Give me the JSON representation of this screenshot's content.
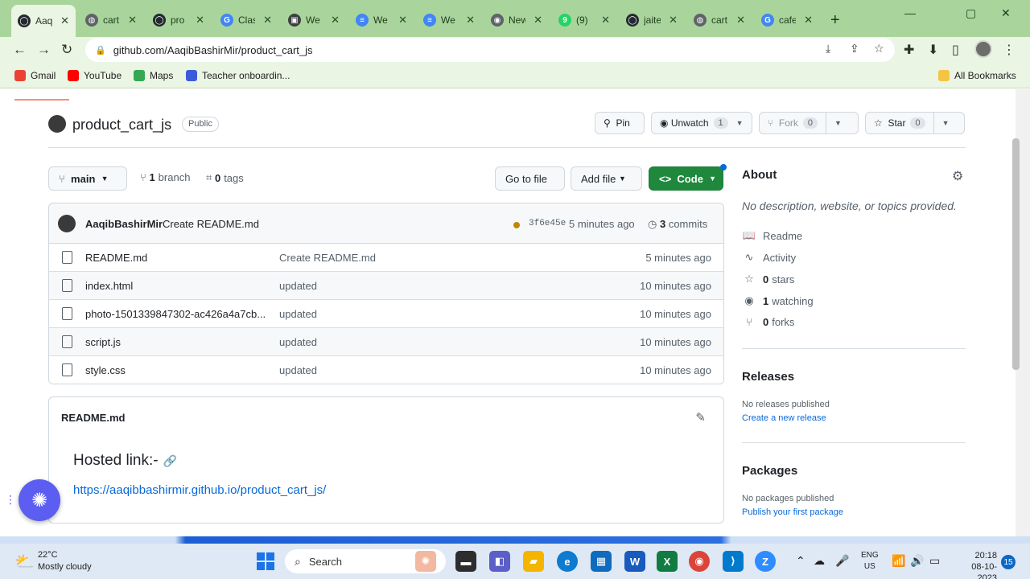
{
  "browser": {
    "tabs": [
      {
        "label": "Aaq",
        "icon": "github-icon",
        "color": "#24292f",
        "glyph": "◯"
      },
      {
        "label": "cart",
        "icon": "globe-icon",
        "color": "#5f6368",
        "glyph": "◍"
      },
      {
        "label": "pro",
        "icon": "github-icon",
        "color": "#24292f",
        "glyph": "◯"
      },
      {
        "label": "Clas",
        "icon": "google-icon",
        "color": "#4285f4",
        "glyph": "G"
      },
      {
        "label": "We",
        "icon": "classroom-icon",
        "color": "#3c4043",
        "glyph": "▣"
      },
      {
        "label": "We",
        "icon": "docs-icon",
        "color": "#4285f4",
        "glyph": "≡"
      },
      {
        "label": "We",
        "icon": "docs-icon",
        "color": "#4285f4",
        "glyph": "≡"
      },
      {
        "label": "New",
        "icon": "chrome-icon",
        "color": "#5f6368",
        "glyph": "◉"
      },
      {
        "label": "(9)",
        "icon": "whatsapp-icon",
        "color": "#25d366",
        "glyph": "9"
      },
      {
        "label": "jaite",
        "icon": "github-icon",
        "color": "#24292f",
        "glyph": "◯"
      },
      {
        "label": "cart",
        "icon": "globe-icon",
        "color": "#5f6368",
        "glyph": "◍"
      },
      {
        "label": "cafe",
        "icon": "google-icon",
        "color": "#4285f4",
        "glyph": "G"
      }
    ],
    "url": "github.com/AaqibBashirMir/product_cart_js",
    "bookmarks": [
      {
        "label": "Gmail",
        "color": "#ea4335"
      },
      {
        "label": "YouTube",
        "color": "#ff0000"
      },
      {
        "label": "Maps",
        "color": "#34a853"
      },
      {
        "label": "Teacher onboardin...",
        "color": "#3b5bdb"
      }
    ],
    "all_bookmarks": "All Bookmarks"
  },
  "repo": {
    "name": "product_cart_js",
    "visibility": "Public",
    "pin": "Pin",
    "unwatch": "Unwatch",
    "watch_count": "1",
    "fork": "Fork",
    "fork_count": "0",
    "star": "Star",
    "star_count": "0",
    "branch": "main",
    "branch_count": "1",
    "branch_label": "branch",
    "tag_count": "0",
    "tag_label": "tags",
    "go_to_file": "Go to file",
    "add_file": "Add file",
    "code": "Code"
  },
  "commit": {
    "author": "AaqibBashirMir",
    "message": "Create README.md",
    "sha": "3f6e45e",
    "time": "5 minutes ago",
    "count": "3",
    "count_label": "commits"
  },
  "files": [
    {
      "name": "README.md",
      "message": "Create README.md",
      "time": "5 minutes ago"
    },
    {
      "name": "index.html",
      "message": "updated",
      "time": "10 minutes ago"
    },
    {
      "name": "photo-1501339847302-ac426a4a7cb...",
      "message": "updated",
      "time": "10 minutes ago"
    },
    {
      "name": "script.js",
      "message": "updated",
      "time": "10 minutes ago"
    },
    {
      "name": "style.css",
      "message": "updated",
      "time": "10 minutes ago"
    }
  ],
  "readme": {
    "filename": "README.md",
    "heading": "Hosted link:-",
    "link": "https://aaqibbashirmir.github.io/product_cart_js/"
  },
  "about": {
    "title": "About",
    "description": "No description, website, or topics provided.",
    "readme": "Readme",
    "activity": "Activity",
    "stars_count": "0",
    "stars_label": "stars",
    "watching_count": "1",
    "watching_label": "watching",
    "forks_count": "0",
    "forks_label": "forks"
  },
  "releases": {
    "title": "Releases",
    "none": "No releases published",
    "create": "Create a new release"
  },
  "packages": {
    "title": "Packages",
    "none": "No packages published",
    "publish": "Publish your first package"
  },
  "taskbar": {
    "temperature": "22°C",
    "weather": "Mostly cloudy",
    "search": "Search",
    "lang_top": "ENG",
    "lang_bottom": "US",
    "time": "20:18",
    "date": "08-10-2023",
    "notifications": "15"
  }
}
